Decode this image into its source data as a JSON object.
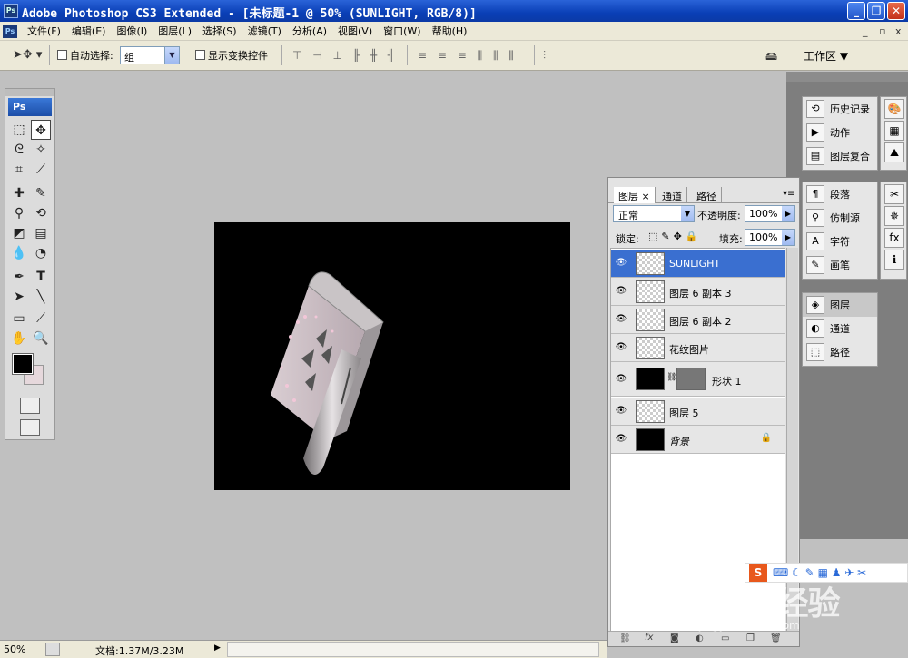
{
  "window": {
    "title": "Adobe Photoshop CS3 Extended - [未标题-1 @ 50% (SUNLIGHT, RGB/8)]",
    "logo": "Ps",
    "controls": [
      "minimize",
      "maximize",
      "close"
    ]
  },
  "menu": {
    "items": [
      "文件(F)",
      "编辑(E)",
      "图像(I)",
      "图层(L)",
      "选择(S)",
      "滤镜(T)",
      "分析(A)",
      "视图(V)",
      "窗口(W)",
      "帮助(H)"
    ],
    "mdi_controls": [
      "_",
      "▫",
      "x"
    ]
  },
  "options": {
    "auto_select_label": "自动选择:",
    "auto_select_value": "组",
    "show_transform_label": "显示变换控件",
    "workspace_label": "工作区 ▼"
  },
  "tools": {
    "logo": "Ps",
    "fg_color": "#000000",
    "bg_color": "#e6d8dc"
  },
  "dock": {
    "group1": [
      "历史记录",
      "动作",
      "图层复合"
    ],
    "group2": [
      "段落",
      "仿制源",
      "字符",
      "画笔"
    ],
    "group3": [
      "图层",
      "通道",
      "路径"
    ],
    "group3_active": "图层"
  },
  "layers_panel": {
    "tabs": [
      "图层 ×",
      "通道",
      "路径"
    ],
    "active_tab": "图层 ×",
    "blend_mode": "正常",
    "opacity_label": "不透明度:",
    "opacity_value": "100%",
    "lock_label": "锁定:",
    "fill_label": "填充:",
    "fill_value": "100%",
    "layers": [
      {
        "name": "SUNLIGHT",
        "thumb": "checker",
        "selected": true
      },
      {
        "name": "图层 6 副本 3",
        "thumb": "checker",
        "selected": false
      },
      {
        "name": "图层 6 副本 2",
        "thumb": "checker",
        "selected": false
      },
      {
        "name": "花纹图片",
        "thumb": "checker",
        "selected": false
      },
      {
        "name": "形状 1",
        "thumb": "black",
        "mask": "grey",
        "selected": false
      },
      {
        "name": "图层 5",
        "thumb": "checker",
        "selected": false
      },
      {
        "name": "背景",
        "thumb": "black",
        "locked": true,
        "selected": false
      }
    ]
  },
  "status": {
    "zoom": "50%",
    "doc_info": "文档:1.37M/3.23M"
  },
  "watermark": {
    "brand": "Baidu经验",
    "url": "jingyan.baidu.com"
  }
}
